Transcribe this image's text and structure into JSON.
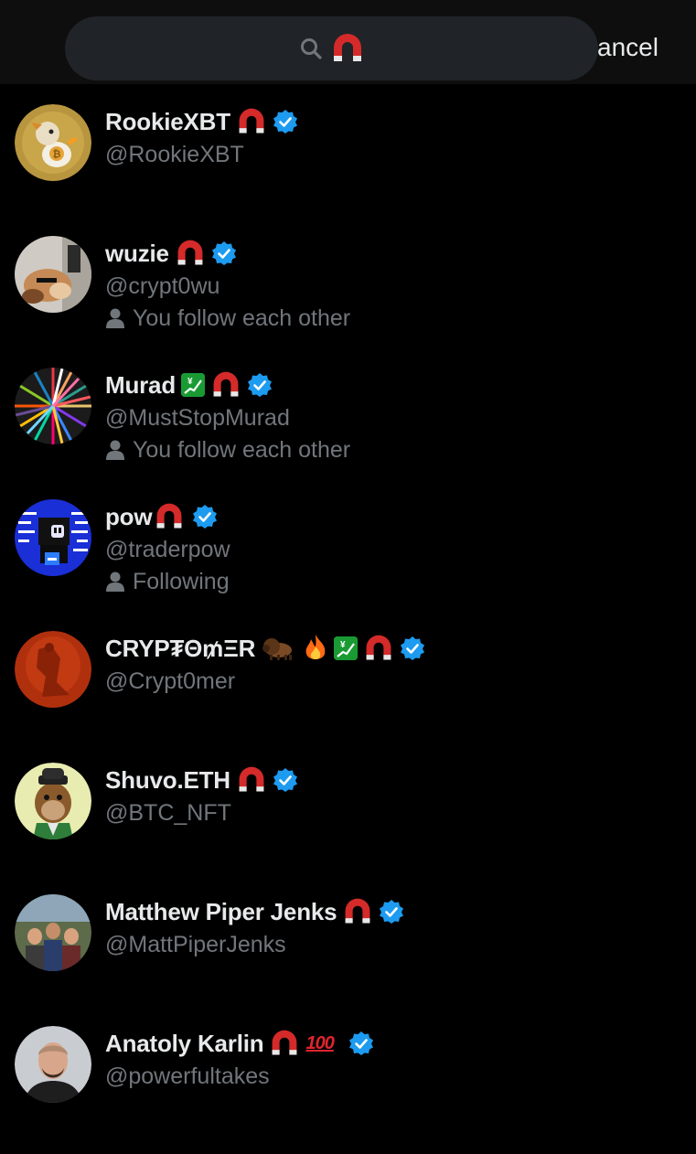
{
  "search": {
    "query_icon": "magnet-icon",
    "cancel_label": "ancel"
  },
  "colors": {
    "background": "#000000",
    "search_bg": "#202327",
    "text_primary": "#e7e9ea",
    "text_secondary": "#71767b",
    "verified_blue": "#1d9bf0",
    "magnet_red": "#d42a2a"
  },
  "users": [
    {
      "name": "RookieXBT",
      "handle": "@RookieXBT",
      "relation": "",
      "emojis": [
        "magnet-icon"
      ],
      "verified": true
    },
    {
      "name": "wuzie",
      "handle": "@crypt0wu",
      "relation": "You follow each other",
      "emojis": [
        "magnet-icon"
      ],
      "verified": true
    },
    {
      "name": "Murad",
      "handle": "@MustStopMurad",
      "relation": "You follow each other",
      "emojis": [
        "chart-yen-icon",
        "magnet-icon"
      ],
      "verified": true
    },
    {
      "name": "pow",
      "handle": "@traderpow",
      "relation": "Following",
      "emojis": [
        "magnet-icon"
      ],
      "verified": true
    },
    {
      "name": "CRYP₮Θ₥ΞR",
      "handle": "@Crypt0mer",
      "relation": "",
      "emojis": [
        "bison-icon",
        "fire-icon",
        "chart-yen-icon",
        "magnet-icon"
      ],
      "verified": true
    },
    {
      "name": "Shuvo.ETH",
      "handle": "@BTC_NFT",
      "relation": "",
      "emojis": [
        "magnet-icon"
      ],
      "verified": true
    },
    {
      "name": "Matthew Piper Jenks",
      "handle": "@MattPiperJenks",
      "relation": "",
      "emojis": [
        "magnet-icon"
      ],
      "verified": true
    },
    {
      "name": "Anatoly Karlin",
      "handle": "@powerfultakes",
      "relation": "",
      "emojis": [
        "magnet-icon",
        "hundred-points-icon"
      ],
      "verified": true
    }
  ],
  "emoji_text": {
    "hundred": "100",
    "yen_chart": "¥"
  }
}
